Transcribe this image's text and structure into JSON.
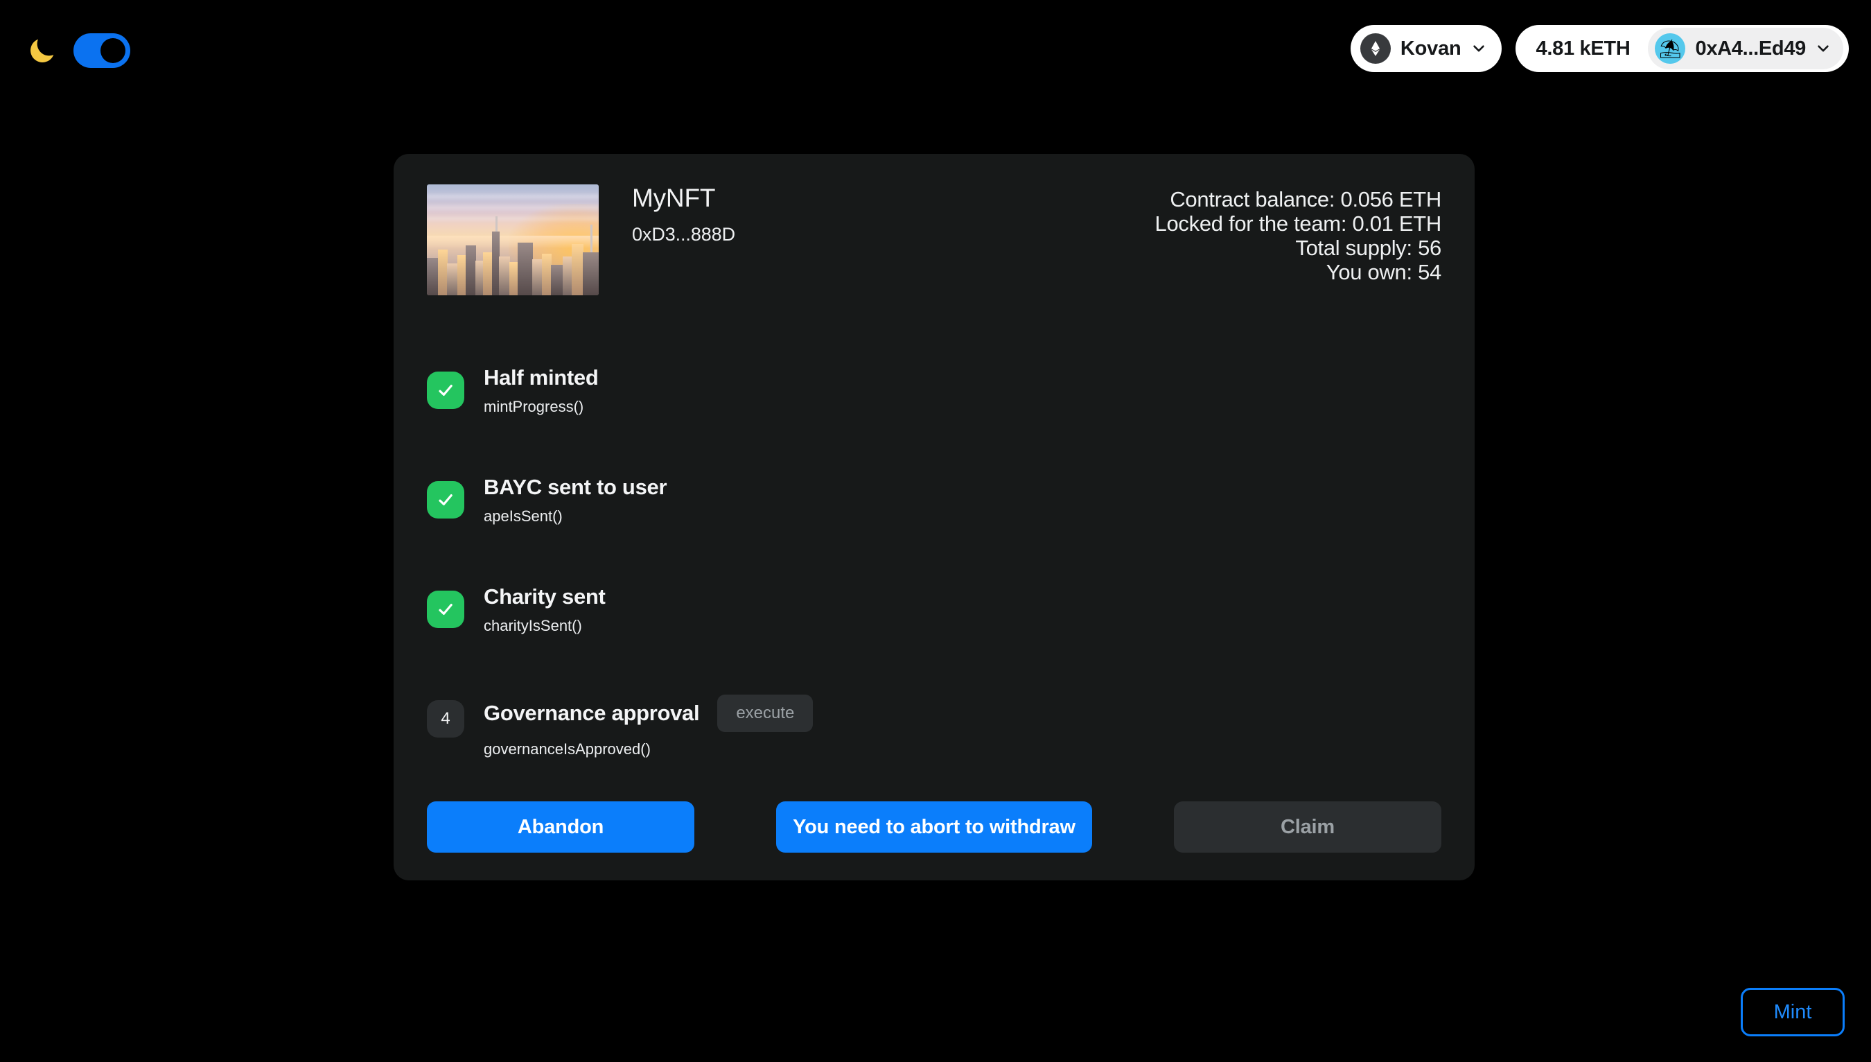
{
  "theme": {
    "icon": "moon-icon",
    "toggle_on": true,
    "accent": "#0b72f0"
  },
  "header": {
    "network": {
      "icon": "ethereum-icon",
      "label": "Kovan",
      "chevron": "chevron-down-icon"
    },
    "wallet": {
      "balance": "4.81 kETH",
      "avatar": "umbrella-avatar-icon",
      "avatar_glyph": "⛱",
      "address": "0xA4...Ed49",
      "chevron": "chevron-down-icon"
    }
  },
  "card": {
    "nft": {
      "thumbnail_alt": "nyc-skyline-sunset",
      "name": "MyNFT",
      "address": "0xD3...888D"
    },
    "stats": [
      "Contract balance: 0.056 ETH",
      "Locked for the team: 0.01 ETH",
      "Total supply: 56",
      "You own: 54"
    ],
    "steps": [
      {
        "index": "1",
        "state": "done",
        "title": "Half minted",
        "fn": "mintProgress()",
        "action": null
      },
      {
        "index": "2",
        "state": "done",
        "title": "BAYC sent to user",
        "fn": "apeIsSent()",
        "action": null
      },
      {
        "index": "3",
        "state": "done",
        "title": "Charity sent",
        "fn": "charityIsSent()",
        "action": null
      },
      {
        "index": "4",
        "state": "todo",
        "title": "Governance approval",
        "fn": "governanceIsApproved()",
        "action": "execute"
      }
    ],
    "actions": {
      "abandon": "Abandon",
      "withdraw": "You need to abort to withdraw",
      "claim": "Claim"
    }
  },
  "footer": {
    "mint": "Mint"
  },
  "colors": {
    "background": "#000000",
    "card": "#171919",
    "accent_blue": "#0b7efb",
    "success_green": "#24c55f",
    "disabled_gray": "#2b2e30",
    "disabled_text": "#9ba1a5"
  }
}
